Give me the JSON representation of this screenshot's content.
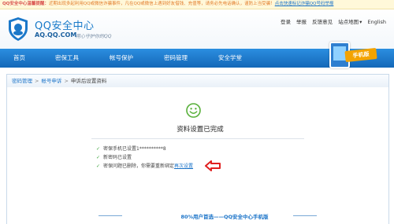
{
  "notice": {
    "label": "QQ安全中心温馨提醒：",
    "message": "近期出现多起利用QQ或微信诈骗事件，凡在QQ或微信上遇到好友借钱、充值等，请务必先电话确认，谨防上当受骗！",
    "link": "点击快速标记诈骗QQ号码举报"
  },
  "brand": {
    "title": "QQ安全中心",
    "url": "AQ.QQ.COM",
    "slogan": "用心守护你的QQ"
  },
  "toplinks": [
    "登录",
    "举报",
    "反馈意见",
    "站点地图",
    "▾",
    "English"
  ],
  "nav": {
    "items": [
      "首页",
      "密保工具",
      "帐号保护",
      "密码管理",
      "安全学堂"
    ],
    "promo_tag": "手机版"
  },
  "breadcrumb": {
    "items": [
      "密码管理",
      "帐号申诉",
      "申诉后设置资料"
    ],
    "separator": ">"
  },
  "result": {
    "title": "资料设置已完成",
    "rows": [
      {
        "text": "密保手机已设置1**********8"
      },
      {
        "text": "新密码已设置"
      },
      {
        "text": "密保问题已删除，你需要重新绑定",
        "link": "再次设置"
      }
    ]
  },
  "promo": {
    "text": "80%用户首选——QQ安全中心手机版"
  },
  "colors": {
    "nav": "#1b78c9",
    "accent": "#1a73c8",
    "check": "#3aa33a",
    "arrow": "#e02020",
    "smile": "#58b03a"
  }
}
